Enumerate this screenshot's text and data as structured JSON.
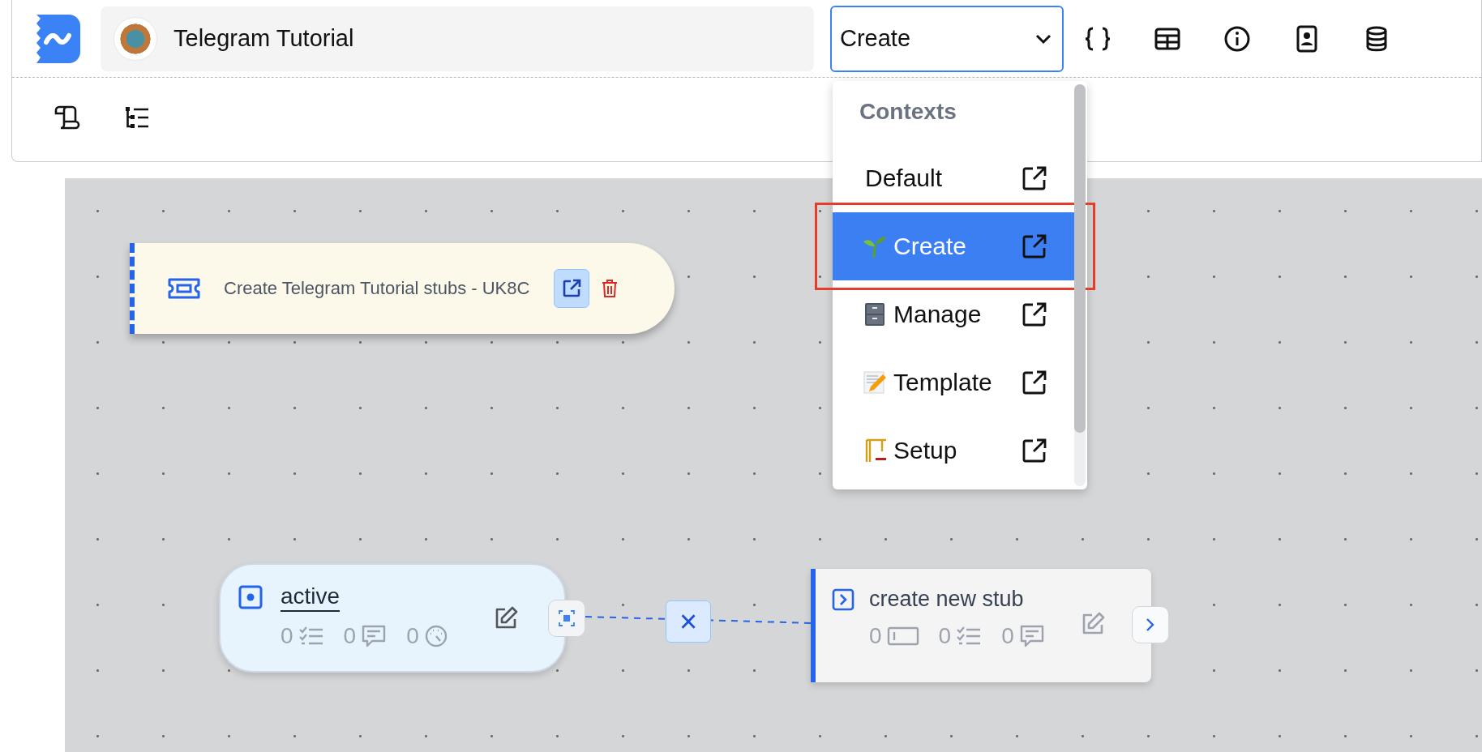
{
  "header": {
    "project_title": "Telegram Tutorial",
    "context_select": {
      "value": "Create"
    }
  },
  "context_menu": {
    "heading": "Contexts",
    "items": [
      {
        "label": "Default",
        "selected": false
      },
      {
        "label": "Create",
        "selected": true
      },
      {
        "label": "Manage",
        "selected": false
      },
      {
        "label": "Template",
        "selected": false
      },
      {
        "label": "Setup",
        "selected": false
      }
    ]
  },
  "canvas": {
    "ticket_node": {
      "title": "Create Telegram Tutorial stubs - UK8C"
    },
    "state_node": {
      "label": "active",
      "counts": [
        "0",
        "0",
        "0"
      ]
    },
    "edge": {
      "delete_label": "×"
    },
    "step_node": {
      "label": "create new stub",
      "counts": [
        "0",
        "0",
        "0"
      ]
    }
  }
}
